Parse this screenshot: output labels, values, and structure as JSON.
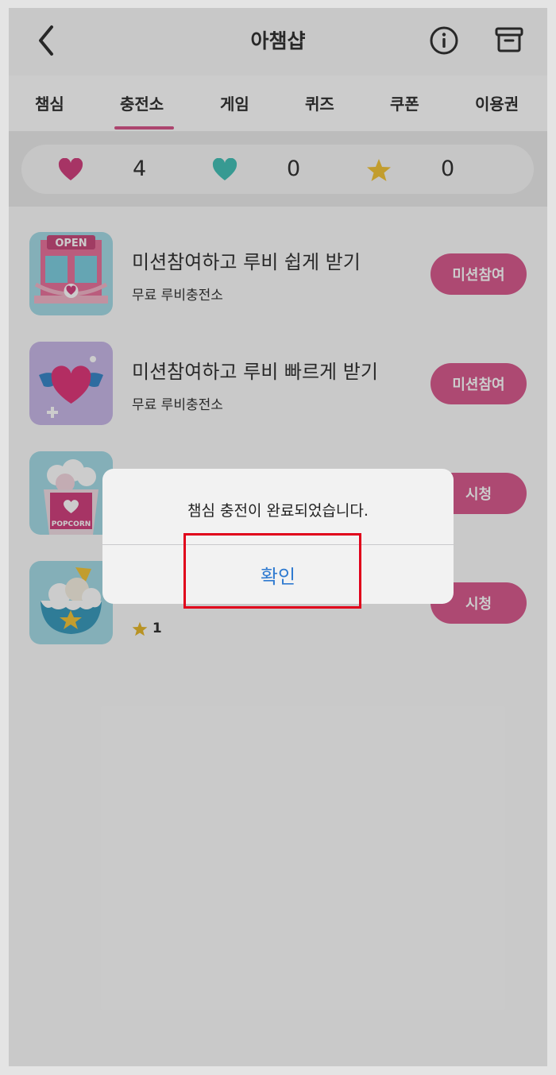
{
  "header": {
    "title": "아챔샵",
    "back_icon": "chevron-left-icon",
    "info_icon": "info-icon",
    "archive_icon": "archive-box-icon"
  },
  "tabs": [
    {
      "label": "챔심",
      "active": false
    },
    {
      "label": "충전소",
      "active": true
    },
    {
      "label": "게임",
      "active": false
    },
    {
      "label": "퀴즈",
      "active": false
    },
    {
      "label": "쿠폰",
      "active": false
    },
    {
      "label": "이용권",
      "active": false
    }
  ],
  "balance": {
    "pink_heart": "4",
    "teal_heart": "0",
    "star": "0"
  },
  "items": [
    {
      "title": "미션참여하고 루비 쉽게 받기",
      "subtitle": "무료 루비충전소",
      "button": "미션참여",
      "thumb_text": "OPEN"
    },
    {
      "title": "미션참여하고 루비 빠르게 받기",
      "subtitle": "무료 루비충전소",
      "button": "미션참여"
    },
    {
      "button": "시청",
      "thumb_text": "POPCORN"
    },
    {
      "reward": "1",
      "button": "시청"
    }
  ],
  "dialog": {
    "message": "챔심 충전이 완료되었습니다.",
    "confirm": "확인"
  },
  "colors": {
    "accent": "#d95c8f",
    "dialog_button": "#2f7ad0",
    "highlight": "#e0001b"
  }
}
